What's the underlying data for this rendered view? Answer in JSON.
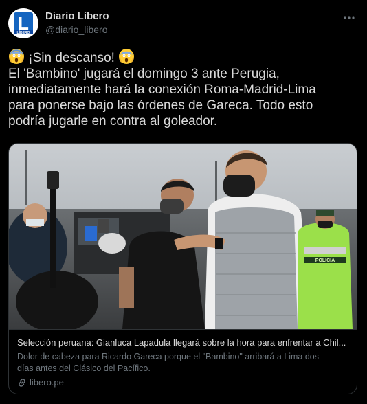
{
  "account": {
    "name": "Diario Líbero",
    "handle": "@diario_libero",
    "avatar_letter": "L",
    "avatar_caption": "LÍBERO"
  },
  "tweet": {
    "line1": "¡Sin descanso!",
    "line2": "El 'Bambino' jugará el domingo 3 ante Perugia,",
    "line3": "inmediatamente hará la conexión Roma-Madrid-Lima",
    "line4": "para ponerse bajo las órdenes de Gareca. Todo esto",
    "line5": "podría jugarle en contra al goleador."
  },
  "card": {
    "title": "Selección peruana: Gianluca Lapadula llegará sobre la hora para enfrentar a Chil...",
    "desc_line1": "Dolor de cabeza para Ricardo Gareca porque el \"Bambino\" arribará a Lima dos",
    "desc_line2": "días antes del Clásico del Pacífico.",
    "domain": "libero.pe",
    "photo_badge": "POLICÍA"
  },
  "icons": {
    "more": "more-horizontal-icon",
    "emoji": "face-screaming-in-fear-icon",
    "link": "link-icon"
  },
  "colors": {
    "background": "#000000",
    "text": "#d9d9d9",
    "muted": "#6e767d",
    "border": "#2f3336",
    "brand_blue": "#1565c0"
  }
}
